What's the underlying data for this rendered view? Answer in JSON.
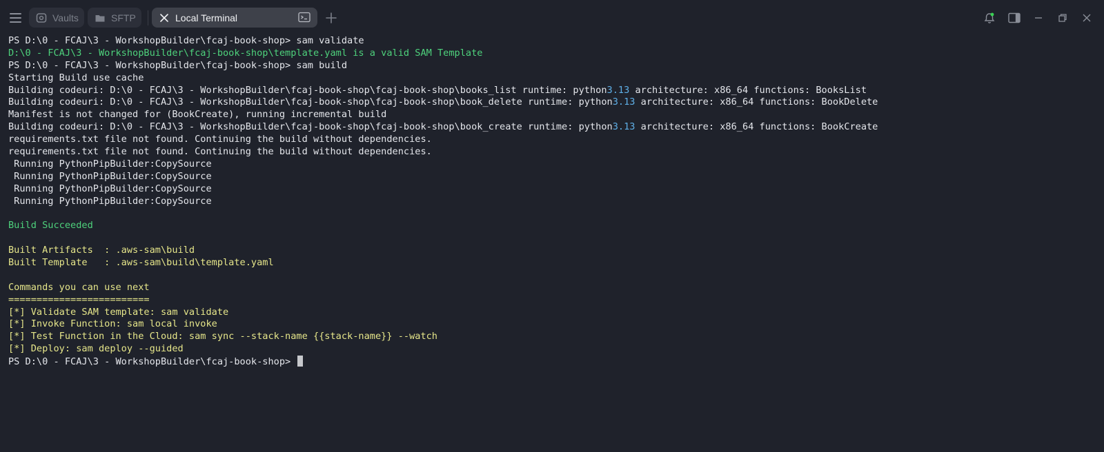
{
  "tabs": [
    {
      "label": "Vaults",
      "icon": "vault-icon",
      "active": false
    },
    {
      "label": "SFTP",
      "icon": "folder-icon",
      "active": false
    },
    {
      "label": "Local Terminal",
      "icon": "close-icon",
      "active": true
    }
  ],
  "terminal": {
    "lines": [
      {
        "text": "PS D:\\0 - FCAJ\\3 - WorkshopBuilder\\fcaj-book-shop> sam validate",
        "color": "default"
      },
      {
        "text": "D:\\0 - FCAJ\\3 - WorkshopBuilder\\fcaj-book-shop\\template.yaml is a valid SAM Template",
        "color": "green"
      },
      {
        "text": "PS D:\\0 - FCAJ\\3 - WorkshopBuilder\\fcaj-book-shop> sam build",
        "color": "default"
      },
      {
        "text": "Starting Build use cache",
        "color": "default"
      },
      {
        "text": "Building codeuri: D:\\0 - FCAJ\\3 - WorkshopBuilder\\fcaj-book-shop\\fcaj-book-shop\\books_list runtime: python3.13 architecture: x86_64 functions: BooksList",
        "color": "default"
      },
      {
        "text": "Building codeuri: D:\\0 - FCAJ\\3 - WorkshopBuilder\\fcaj-book-shop\\fcaj-book-shop\\book_delete runtime: python3.13 architecture: x86_64 functions: BookDelete",
        "color": "default"
      },
      {
        "text": "Manifest is not changed for (BookCreate), running incremental build",
        "color": "default"
      },
      {
        "text": "Building codeuri: D:\\0 - FCAJ\\3 - WorkshopBuilder\\fcaj-book-shop\\fcaj-book-shop\\book_create runtime: python3.13 architecture: x86_64 functions: BookCreate",
        "color": "default"
      },
      {
        "text": "requirements.txt file not found. Continuing the build without dependencies.",
        "color": "default"
      },
      {
        "text": "requirements.txt file not found. Continuing the build without dependencies.",
        "color": "default"
      },
      {
        "text": " Running PythonPipBuilder:CopySource",
        "color": "default"
      },
      {
        "text": " Running PythonPipBuilder:CopySource",
        "color": "default"
      },
      {
        "text": " Running PythonPipBuilder:CopySource",
        "color": "default"
      },
      {
        "text": " Running PythonPipBuilder:CopySource",
        "color": "default"
      },
      {
        "text": "",
        "color": "default"
      },
      {
        "text": "Build Succeeded",
        "color": "green"
      },
      {
        "text": "",
        "color": "default"
      },
      {
        "text": "Built Artifacts  : .aws-sam\\build",
        "color": "yellow"
      },
      {
        "text": "Built Template   : .aws-sam\\build\\template.yaml",
        "color": "yellow"
      },
      {
        "text": "",
        "color": "default"
      },
      {
        "text": "Commands you can use next",
        "color": "yellow"
      },
      {
        "text": "=========================",
        "color": "yellow"
      },
      {
        "text": "[*] Validate SAM template: sam validate",
        "color": "yellow"
      },
      {
        "text": "[*] Invoke Function: sam local invoke",
        "color": "yellow"
      },
      {
        "text": "[*] Test Function in the Cloud: sam sync --stack-name {{stack-name}} --watch",
        "color": "yellow"
      },
      {
        "text": "[*] Deploy: sam deploy --guided",
        "color": "yellow"
      }
    ],
    "prompt": "PS D:\\0 - FCAJ\\3 - WorkshopBuilder\\fcaj-book-shop> "
  },
  "colors": {
    "background": "#1f222b",
    "green": "#4ed27c",
    "yellow": "#e6e68a",
    "number_blue": "#5fb0e8",
    "notification_dot": "#39d353"
  }
}
